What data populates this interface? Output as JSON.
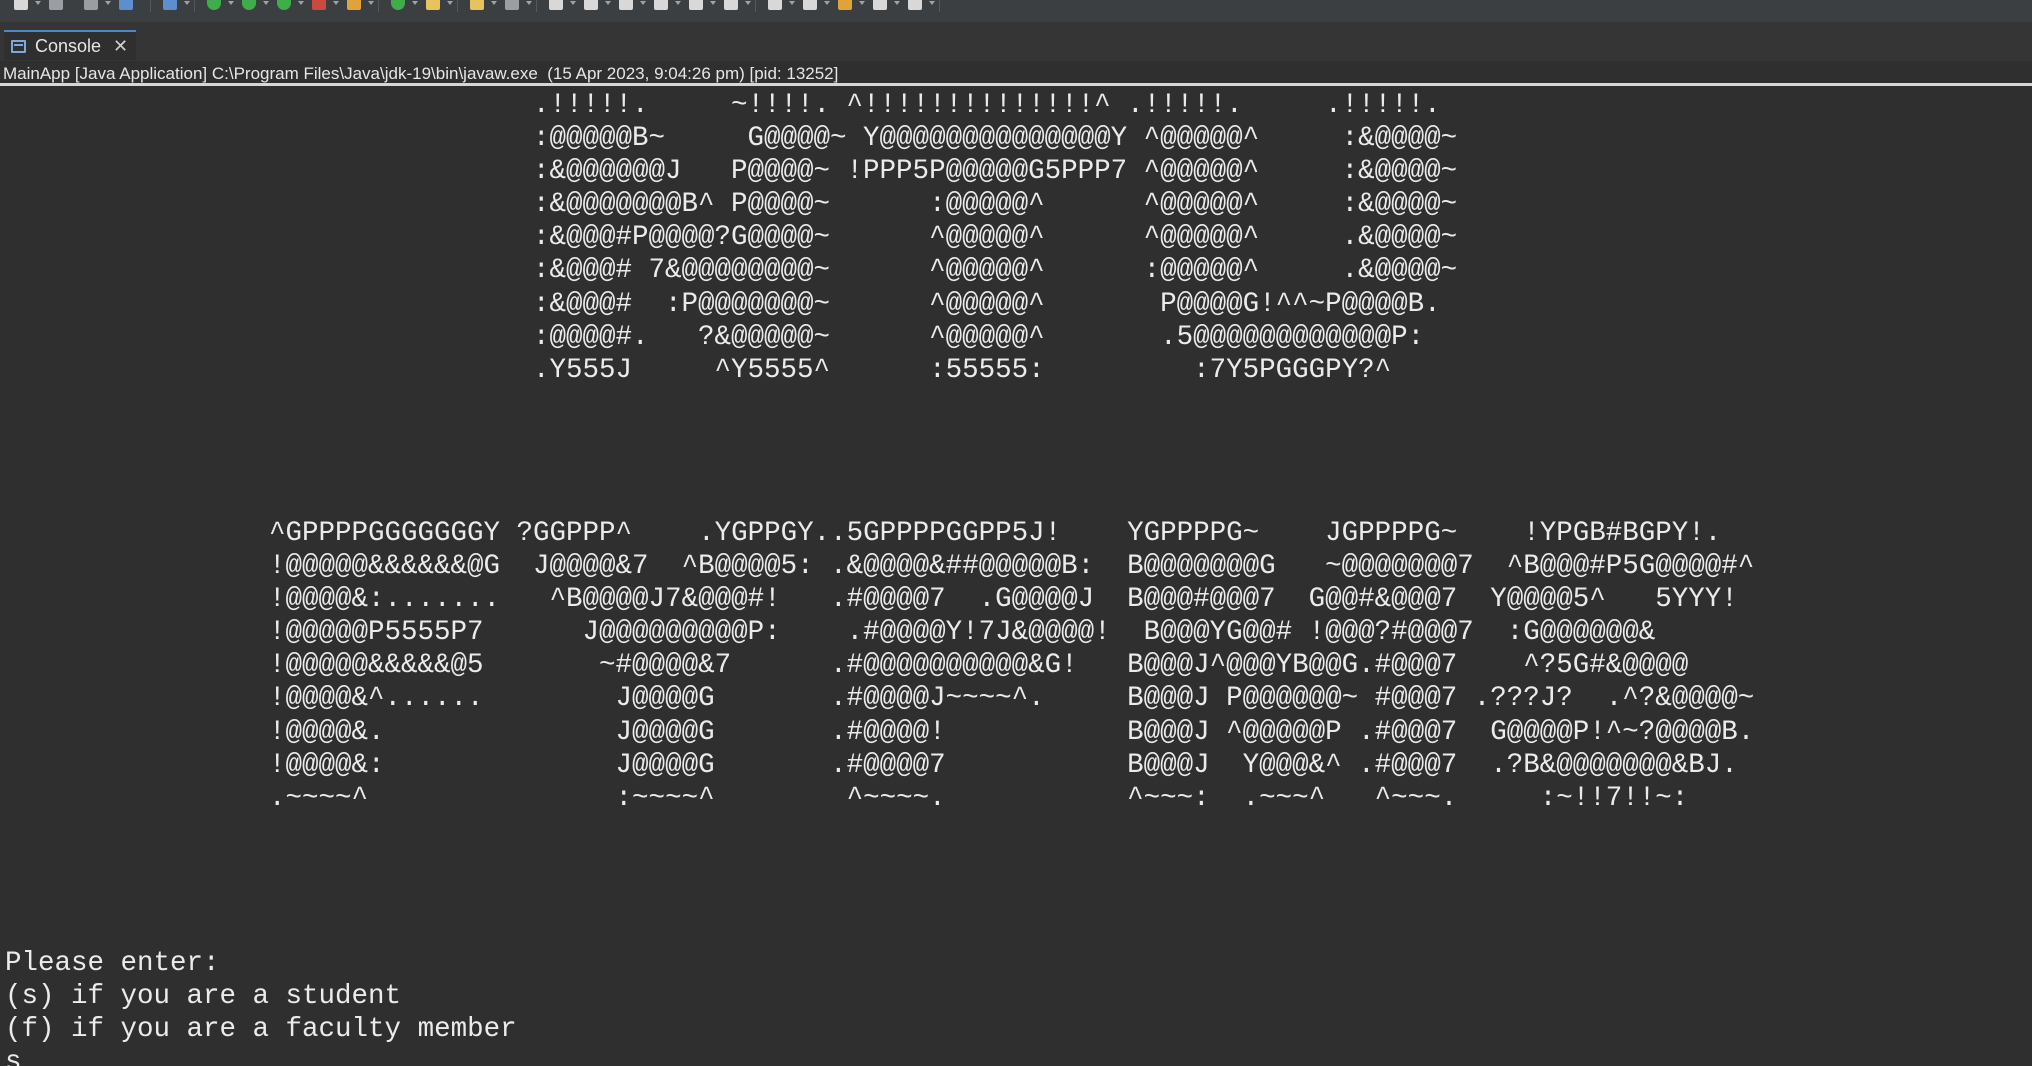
{
  "toolbar": {
    "buttons": [
      {
        "icon": "new-file-icon",
        "color": "white"
      },
      {
        "icon": "save-icon",
        "color": "gray"
      },
      {
        "icon": "save-all-icon",
        "color": "gray"
      },
      {
        "icon": "terminal-icon",
        "color": "blue"
      },
      {
        "icon": "search-icon",
        "color": "blue"
      },
      {
        "icon": "debug-icon",
        "color": "green"
      },
      {
        "icon": "run-icon",
        "color": "green"
      },
      {
        "icon": "coverage-icon",
        "color": "green"
      },
      {
        "icon": "external-tools-icon",
        "color": "red"
      },
      {
        "icon": "build-icon",
        "color": "orange"
      },
      {
        "icon": "refresh-icon",
        "color": "green"
      },
      {
        "icon": "open-folder-icon",
        "color": "yellow"
      },
      {
        "icon": "pencil-icon",
        "color": "yellow"
      },
      {
        "icon": "pin-icon",
        "color": "gray"
      },
      {
        "icon": "brush-icon",
        "color": "white"
      },
      {
        "icon": "copy-icon",
        "color": "white"
      },
      {
        "icon": "document-icon",
        "color": "white"
      },
      {
        "icon": "paragraph-icon",
        "color": "white"
      },
      {
        "icon": "annotation-icon",
        "color": "white"
      },
      {
        "icon": "step-icon",
        "color": "white"
      },
      {
        "icon": "back-icon",
        "color": "white"
      },
      {
        "icon": "forward-icon",
        "color": "white"
      },
      {
        "icon": "last-edit-icon",
        "color": "orange"
      },
      {
        "icon": "next-edit-icon",
        "color": "white"
      },
      {
        "icon": "task-icon",
        "color": "white"
      }
    ]
  },
  "tab": {
    "label": "Console",
    "close": "✕"
  },
  "status": {
    "text": "MainApp [Java Application] C:\\Program Files\\Java\\jdk-19\\bin\\javaw.exe  (15 Apr 2023, 9:04:26 pm) [pid: 13252]"
  },
  "console": {
    "banner_top": ".!!!!!.     ~!!!!. ^!!!!!!!!!!!!!!^ .!!!!!.     .!!!!!.\n:@@@@@B~     G@@@@~ Y@@@@@@@@@@@@@@Y ^@@@@@^     :&@@@@~\n:&@@@@@@J   P@@@@~ !PPP5P@@@@@G5PPP7 ^@@@@@^     :&@@@@~\n:&@@@@@@@B^ P@@@@~      :@@@@@^      ^@@@@@^     :&@@@@~\n:&@@@#P@@@@?G@@@@~      ^@@@@@^      ^@@@@@^     .&@@@@~\n:&@@@# 7&@@@@@@@@~      ^@@@@@^      :@@@@@^     .&@@@@~\n:&@@@#  :P@@@@@@@~      ^@@@@@^       P@@@@G!^^~P@@@@B.\n:@@@@#.   ?&@@@@@~      ^@@@@@^       .5@@@@@@@@@@@@P:\n.Y555J     ^Y5555^      :55555:         :7Y5PGGGPY?^",
    "banner_bottom": "^GPPPPGGGGGGGY ?GGPPP^    .YGPPGY..5GPPPPGGPP5J!    YGPPPPG~    JGPPPPG~    !YPGB#BGPY!.\n!@@@@@&&&&&&@G  J@@@@&7  ^B@@@@5: .&@@@@&##@@@@@B:  B@@@@@@@G   ~@@@@@@@7  ^B@@@#P5G@@@@#^\n!@@@@&:.......   ^B@@@@J7&@@@#!   .#@@@@7  .G@@@@J  B@@@#@@@7  G@@#&@@@7  Y@@@@5^   5YYY!\n!@@@@@P5555P7      J@@@@@@@@@P:    .#@@@@Y!7J&@@@@!  B@@@YG@@# !@@@?#@@@7  :G@@@@@@&\n!@@@@@&&&&&@5       ~#@@@@&7      .#@@@@@@@@@@&G!   B@@@J^@@@YB@@G.#@@@7    ^?5G#&@@@@\n!@@@@&^......        J@@@@G       .#@@@@J~~~~^.     B@@@J P@@@@@@~ #@@@7 .???J?  .^?&@@@@~\n!@@@@&.              J@@@@G       .#@@@@!           B@@@J ^@@@@@P .#@@@7  G@@@@P!^~?@@@@B.\n!@@@@&:              J@@@@G       .#@@@@7           B@@@J  Y@@@&^ .#@@@7  .?B&@@@@@@@&BJ.\n.~~~~^               :~~~~^        ^~~~~.           ^~~~:  .~~~^   ^~~~.     :~!!7!!~:",
    "prompt_lines": [
      "Please enter:",
      "(s) if you are a student",
      "(f) if you are a faculty member",
      "s"
    ]
  }
}
